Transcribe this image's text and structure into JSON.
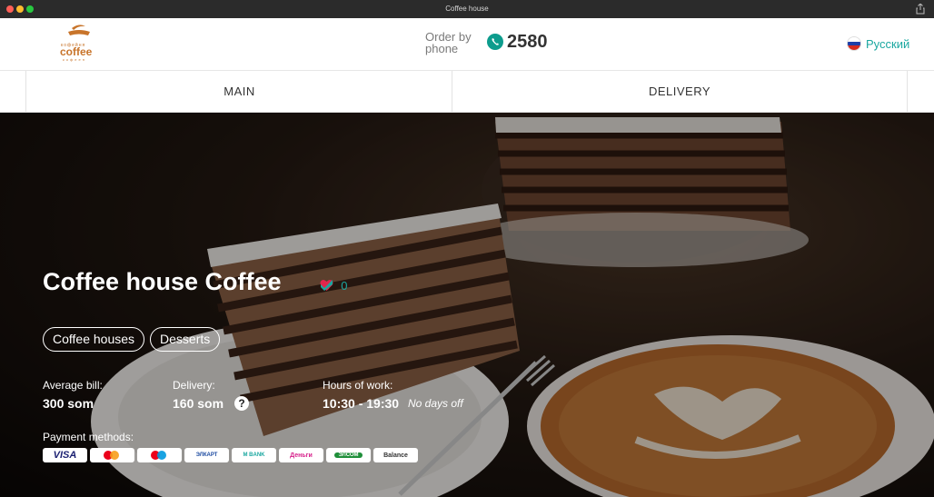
{
  "window": {
    "title": "Coffee house"
  },
  "header": {
    "logo_text": "coffee",
    "order_label": "Order by phone",
    "phone": "2580",
    "language": "Русский"
  },
  "nav": {
    "tabs": [
      {
        "label": "MAIN"
      },
      {
        "label": "DELIVERY"
      }
    ]
  },
  "venue": {
    "title": "Coffee house Coffee",
    "likes": "0",
    "checkins": "0",
    "tags": [
      "Coffee houses",
      "Desserts"
    ],
    "average_bill_label": "Average bill:",
    "average_bill": "300 som",
    "delivery_label": "Delivery:",
    "delivery": "160 som",
    "hours_label": "Hours of work:",
    "hours": "10:30 - 19:30",
    "days_off": "No days off",
    "payment_label": "Payment methods:",
    "payment_methods": [
      {
        "name": "VISA",
        "icon": "visa-icon"
      },
      {
        "name": "Mastercard",
        "icon": "mastercard-icon"
      },
      {
        "name": "Maestro",
        "icon": "maestro-icon"
      },
      {
        "name": "ЭЛКАРТ",
        "icon": "elcart-icon"
      },
      {
        "name": "M BANK",
        "icon": "mbank-icon"
      },
      {
        "name": "Деньги",
        "icon": "o-dengi-icon"
      },
      {
        "name": "ЭЛСОМ",
        "icon": "elsom-icon"
      },
      {
        "name": "Balance",
        "icon": "balance-icon"
      }
    ]
  },
  "colors": {
    "accent": "#1aa7a0",
    "like": "#e0264d",
    "brand": "#c8742a"
  }
}
